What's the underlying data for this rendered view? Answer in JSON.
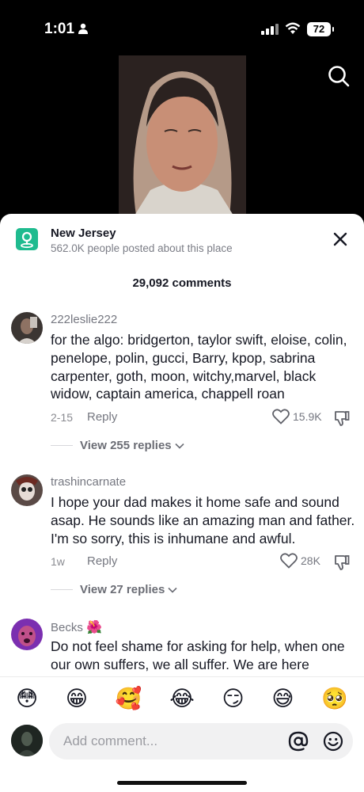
{
  "status_bar": {
    "time": "1:01",
    "battery": "72"
  },
  "place": {
    "name": "New Jersey",
    "subtitle": "562.0K people posted about this place"
  },
  "comments_count": "29,092 comments",
  "comments": [
    {
      "username": "222leslie222",
      "text": "for the algo: bridgerton, taylor swift, eloise, colin, penelope, polin, gucci, Barry, kpop, sabrina carpenter, goth, moon, witchy,marvel, black widow, captain america, chappell roan",
      "date": "2-15",
      "reply_label": "Reply",
      "likes": "15.9K",
      "view_replies": "View 255 replies"
    },
    {
      "username": "trashincarnate",
      "text": "I hope your dad makes it home safe and sound asap. He sounds like an amazing man and father. I'm so sorry, this is inhumane and awful.",
      "date": "1w",
      "reply_label": "Reply",
      "likes": "28K",
      "view_replies": "View 27 replies"
    },
    {
      "username": "Becks",
      "username_emoji": "🌺",
      "text": "Do not feel shame for asking for help, when one our own suffers, we all suffer. We are here"
    }
  ],
  "emoji_bar": [
    "😳",
    "😁",
    "🥰",
    "😂",
    "😏",
    "😅",
    "🥺"
  ],
  "composer": {
    "placeholder": "Add comment..."
  },
  "colors": {
    "accent_place": "#1fbb8f",
    "text_primary": "#161823",
    "text_secondary": "#757780"
  }
}
